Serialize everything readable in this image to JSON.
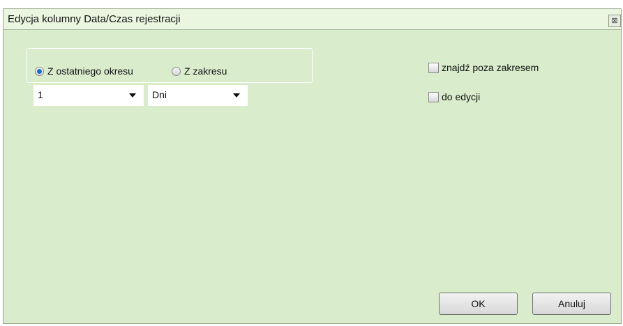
{
  "window": {
    "title": "Edycja kolumny Data/Czas rejestracji",
    "close_glyph": "⊠",
    "close_icon": "close-icon"
  },
  "period": {
    "options": [
      {
        "label": "Z ostatniego okresu",
        "selected": true
      },
      {
        "label": "Z zakresu",
        "selected": false
      }
    ],
    "count": {
      "value": "1"
    },
    "unit": {
      "value": "Dni"
    }
  },
  "options": {
    "outside_range": {
      "label": "znajdź poza zakresem",
      "checked": false
    },
    "for_editing": {
      "label": "do edycji",
      "checked": false
    }
  },
  "buttons": {
    "ok": "OK",
    "cancel": "Anuluj"
  },
  "colors": {
    "dialog_background": "#d9eccc",
    "title_background": "#eaf6df",
    "radio_selected": "#1c6fc9"
  }
}
